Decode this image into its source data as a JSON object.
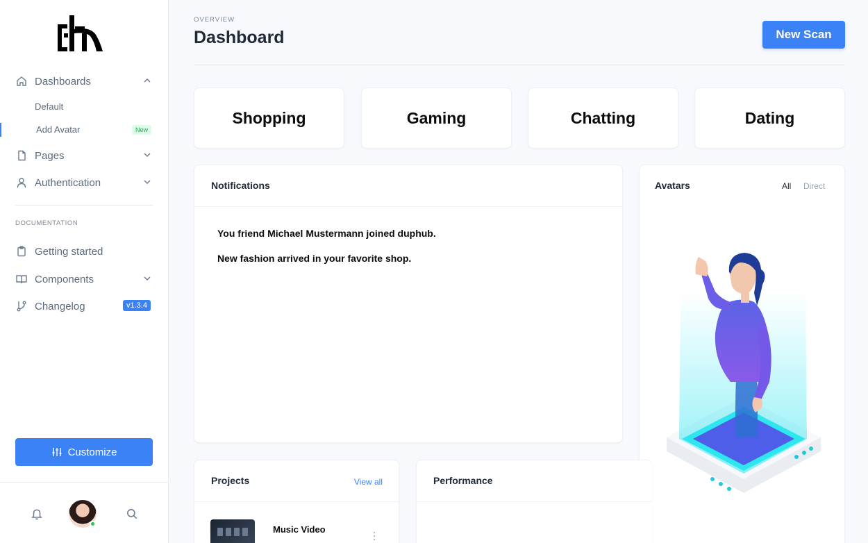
{
  "sidebar": {
    "nav": {
      "dashboards": "Dashboards",
      "default": "Default",
      "add_avatar": "Add Avatar",
      "new_badge": "New",
      "pages": "Pages",
      "authentication": "Authentication"
    },
    "documentation_label": "DOCUMENTATION",
    "docs": {
      "getting_started": "Getting started",
      "components": "Components",
      "changelog": "Changelog",
      "version": "v1.3.4"
    },
    "customize_label": "Customize"
  },
  "header": {
    "overline": "OVERVIEW",
    "title": "Dashboard",
    "new_scan_label": "New Scan"
  },
  "categories": [
    "Shopping",
    "Gaming",
    "Chatting",
    "Dating"
  ],
  "notifications": {
    "title": "Notifications",
    "items": [
      "You friend Michael Mustermann joined duphub.",
      "New fashion arrived in your favorite shop."
    ]
  },
  "avatars": {
    "title": "Avatars",
    "tabs": [
      "All",
      "Direct"
    ]
  },
  "projects": {
    "title": "Projects",
    "view_all": "View all",
    "items": [
      {
        "name": "Music Video"
      }
    ]
  },
  "performance": {
    "title": "Performance"
  },
  "colors": {
    "accent": "#3b82f6",
    "online": "#22c55e",
    "new_badge_bg": "#dcfce7"
  }
}
